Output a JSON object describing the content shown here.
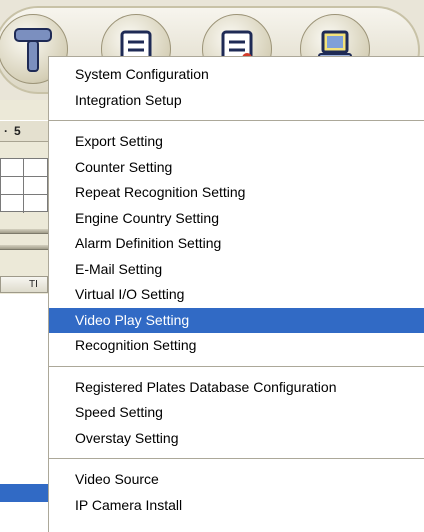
{
  "background_window": {
    "tab_numbers": [
      "5"
    ],
    "column_header_fragment": "TI"
  },
  "toolbar": {
    "buttons": [
      {
        "icon": "tool-icon"
      },
      {
        "icon": "document-icon"
      },
      {
        "icon": "document-edit-icon"
      },
      {
        "icon": "monitor-icon"
      }
    ]
  },
  "context_menu": {
    "sections": [
      {
        "items": [
          "System Configuration",
          "Integration Setup"
        ]
      },
      {
        "items": [
          "Export Setting",
          "Counter Setting",
          "Repeat Recognition Setting",
          "Engine Country Setting",
          "Alarm Definition Setting",
          "E-Mail Setting",
          "Virtual I/O Setting",
          "Video Play Setting",
          "Recognition Setting"
        ]
      },
      {
        "items": [
          "Registered Plates Database Configuration",
          "Speed Setting",
          "Overstay Setting"
        ]
      },
      {
        "items": [
          "Video Source",
          "IP Camera Install"
        ]
      }
    ],
    "highlighted_item": "Video Play Setting",
    "colors": {
      "highlight_bg": "#316ac5",
      "highlight_text": "#ffffff",
      "separator": "#aca899"
    }
  }
}
